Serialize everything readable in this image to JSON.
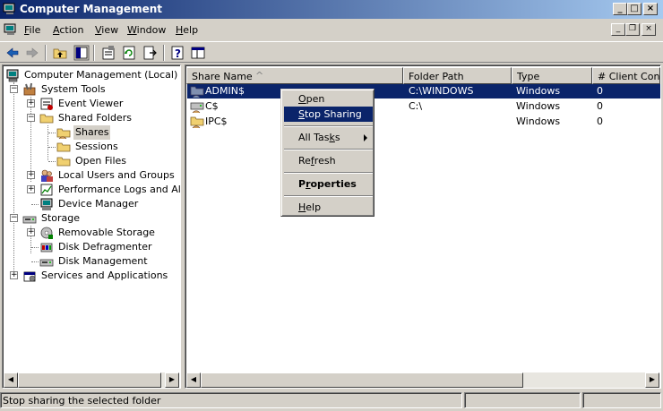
{
  "window": {
    "title": "Computer Management"
  },
  "menubar": {
    "items": [
      {
        "label": "File",
        "accel": "F",
        "rest": "ile"
      },
      {
        "label": "Action",
        "accel": "A",
        "rest": "ction"
      },
      {
        "label": "View",
        "accel": "V",
        "rest": "iew"
      },
      {
        "label": "Window",
        "accel": "W",
        "rest": "indow"
      },
      {
        "label": "Help",
        "accel": "H",
        "rest": "elp"
      }
    ]
  },
  "toolbar": {
    "buttons": [
      "back-icon",
      "forward-icon",
      "up-level-icon",
      "show-hide-tree-icon",
      "properties-icon",
      "refresh-icon",
      "export-list-icon",
      "help-icon",
      "show-hide-console-icon"
    ]
  },
  "tree": {
    "root": "Computer Management (Local)",
    "system_tools": "System Tools",
    "event_viewer": "Event Viewer",
    "shared_folders": "Shared Folders",
    "shares": "Shares",
    "sessions": "Sessions",
    "open_files": "Open Files",
    "local_users": "Local Users and Groups",
    "perf_logs": "Performance Logs and Alerts",
    "device_manager": "Device Manager",
    "storage": "Storage",
    "removable_storage": "Removable Storage",
    "disk_defrag": "Disk Defragmenter",
    "disk_mgmt": "Disk Management",
    "services_apps": "Services and Applications",
    "expanders": {
      "plus": "+",
      "minus": "−"
    }
  },
  "list": {
    "columns": [
      "Share Name",
      "Folder Path",
      "Type",
      "# Client Connections"
    ],
    "sort_indicator": "^",
    "rows": [
      {
        "name": "ADMIN$",
        "path": "C:\\WINDOWS",
        "type": "Windows",
        "clients": "0"
      },
      {
        "name": "C$",
        "path": "C:\\",
        "type": "Windows",
        "clients": "0"
      },
      {
        "name": "IPC$",
        "path": "",
        "type": "Windows",
        "clients": "0"
      }
    ]
  },
  "context_menu": {
    "open": {
      "accel": "O",
      "rest": "pen"
    },
    "stop_sharing": {
      "accel": "S",
      "rest": "top Sharing"
    },
    "all_tasks": {
      "first": "All Tas",
      "accel": "k",
      "rest": "s"
    },
    "refresh": {
      "first": "Re",
      "accel": "f",
      "rest": "resh"
    },
    "properties": {
      "first": "P",
      "accel": "r",
      "rest": "operties"
    },
    "help": {
      "accel": "H",
      "rest": "elp"
    }
  },
  "statusbar": {
    "text": "Stop sharing the selected folder"
  },
  "colors": {
    "title_start": "#0a246a",
    "title_end": "#a6caf0",
    "selection": "#0a246a",
    "face": "#d4d0c8"
  }
}
